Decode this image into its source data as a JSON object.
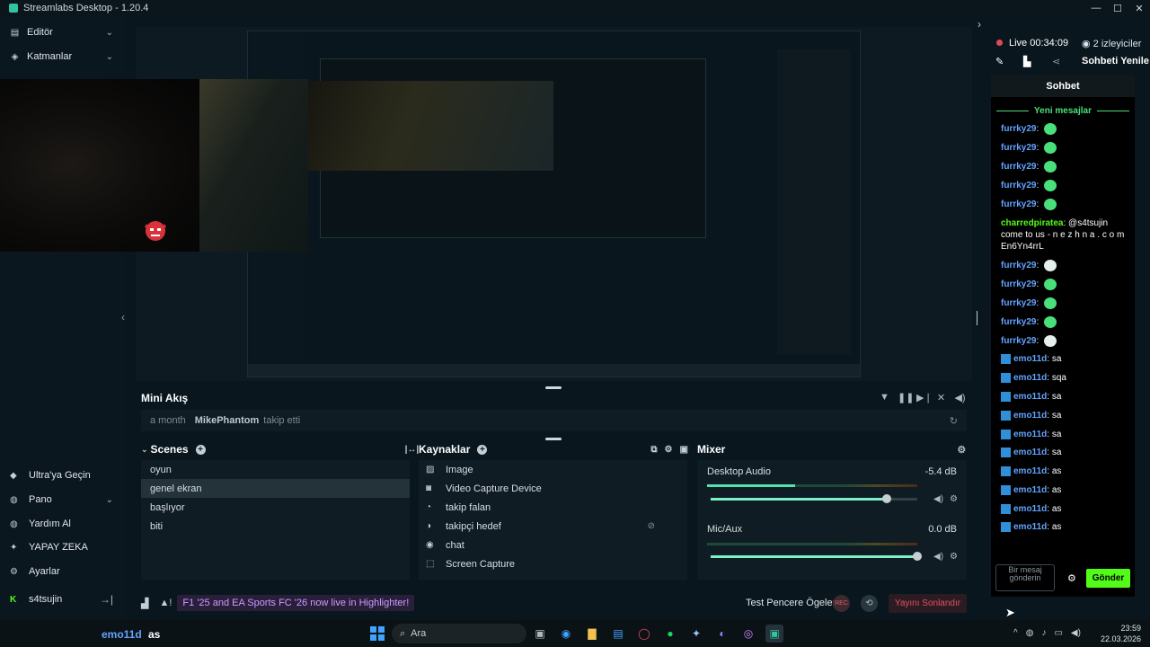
{
  "window": {
    "title": "Streamlabs Desktop - 1.20.4",
    "controls": {
      "min": "—",
      "max": "☐",
      "close": "✕"
    }
  },
  "sidebar": {
    "top": [
      {
        "label": "Editör",
        "icon": "pencil-icon"
      },
      {
        "label": "Katmanlar",
        "icon": "layers-icon"
      }
    ],
    "bottom": [
      {
        "label": "Ultra'ya Geçin",
        "icon": "ultra-icon"
      },
      {
        "label": "Pano",
        "icon": "dashboard-icon"
      },
      {
        "label": "Yardım Al",
        "icon": "help-icon"
      },
      {
        "label": "YAPAY ZEKA",
        "icon": "ai-sparkle-icon"
      },
      {
        "label": "Ayarlar",
        "icon": "gear-icon"
      },
      {
        "label": "s4tsujin",
        "icon": "kick-icon"
      }
    ]
  },
  "mini_feed": {
    "title": "Mini Akış",
    "event": {
      "time": "a month",
      "user": "MikePhantom",
      "action": "takip etti"
    }
  },
  "scenes": {
    "title": "Scenes",
    "items": [
      "oyun",
      "genel ekran",
      "başlıyor",
      "biti"
    ],
    "active": 1
  },
  "sources": {
    "title": "Kaynaklar",
    "items": [
      {
        "label": "Image",
        "icon": "image-icon"
      },
      {
        "label": "Video Capture Device",
        "icon": "camera-icon"
      },
      {
        "label": "takip falan",
        "icon": "alert-icon"
      },
      {
        "label": "takipçi hedef",
        "icon": "goal-icon"
      },
      {
        "label": "chat",
        "icon": "chat-icon"
      },
      {
        "label": "Screen Capture",
        "icon": "screen-capture-icon"
      }
    ]
  },
  "mixer": {
    "title": "Mixer",
    "channels": [
      {
        "name": "Desktop Audio",
        "db": "-5.4 dB",
        "level": 0.42,
        "volume": 0.85
      },
      {
        "name": "Mic/Aux",
        "db": "0.0 dB",
        "level": 0.0,
        "volume": 1.0
      }
    ]
  },
  "footer": {
    "highlight": "F1 '25 and EA Sports FC '26 now live in Highlighter!",
    "test_button": "Test Pencere Ögeleri",
    "rec_label": "REC",
    "end_button": "Yayını Sonlandır"
  },
  "right": {
    "live_label": "Live",
    "live_time": "00:34:09",
    "viewers": "2 izleyiciler",
    "refresh": "Sohbeti Yenile",
    "chat_title": "Sohbet",
    "new_messages": "Yeni mesajlar",
    "messages": [
      {
        "user": "furrky29",
        "text": "",
        "emote": true
      },
      {
        "user": "furrky29",
        "text": "",
        "emote": true
      },
      {
        "user": "furrky29",
        "text": "",
        "emote": true
      },
      {
        "user": "furrky29",
        "text": "",
        "emote": true
      },
      {
        "user": "furrky29",
        "text": "",
        "emote": true
      },
      {
        "user": "charredpiratea",
        "text": "@s4tsujin come to us - n e z h n a . c o m En6Yn4rrL",
        "emote": false
      },
      {
        "user": "furrky29",
        "text": "",
        "emote": true
      },
      {
        "user": "furrky29",
        "text": "",
        "emote": true
      },
      {
        "user": "furrky29",
        "text": "",
        "emote": true
      },
      {
        "user": "furrky29",
        "text": "",
        "emote": true
      },
      {
        "user": "furrky29",
        "text": "",
        "emote": true
      },
      {
        "user": "emo11d",
        "text": "sa",
        "emote": false
      },
      {
        "user": "emo11d",
        "text": "sqa",
        "emote": false
      },
      {
        "user": "emo11d",
        "text": "sa",
        "emote": false
      },
      {
        "user": "emo11d",
        "text": "sa",
        "emote": false
      },
      {
        "user": "emo11d",
        "text": "sa",
        "emote": false
      },
      {
        "user": "emo11d",
        "text": "sa",
        "emote": false
      },
      {
        "user": "emo11d",
        "text": "as",
        "emote": false
      },
      {
        "user": "emo11d",
        "text": "as",
        "emote": false
      },
      {
        "user": "emo11d",
        "text": "as",
        "emote": false
      },
      {
        "user": "emo11d",
        "text": "as",
        "emote": false
      }
    ],
    "input_placeholder": "Bir mesaj gönderin",
    "send": "Gönder"
  },
  "taskbar": {
    "overlay_user": "emo11d",
    "overlay_text": "as",
    "search": "Ara",
    "time": "23:59",
    "date": "22.03.2026"
  },
  "colors": {
    "bg": "#09161d",
    "accent": "#31c3a2",
    "kick_green": "#53fc18",
    "chat_user_blue": "#62a3ff",
    "end_red": "#e5505f"
  }
}
